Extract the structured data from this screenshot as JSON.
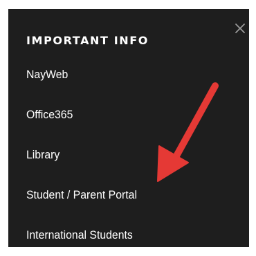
{
  "menu_panel": {
    "heading": "IMPORTANT INFO",
    "close_icon": "close-icon",
    "items": [
      {
        "label": "NayWeb"
      },
      {
        "label": "Office365"
      },
      {
        "label": "Library"
      },
      {
        "label": "Student / Parent Portal"
      },
      {
        "label": "International Students"
      }
    ]
  },
  "annotation": {
    "icon": "red-arrow-icon",
    "color": "#e53935"
  },
  "colors": {
    "panel_background": "#1e1e1e",
    "text": "#ffffff",
    "close_icon": "#9a9a9a"
  }
}
